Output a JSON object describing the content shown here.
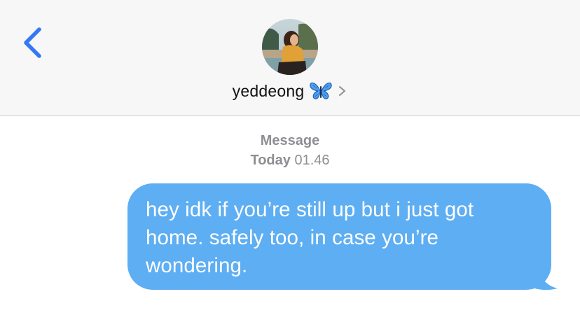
{
  "header": {
    "contact_name": "yeddeong",
    "contact_emoji": "butterfly-icon"
  },
  "conversation": {
    "service_label": "Message",
    "day_label": "Today",
    "time_label": "01.46"
  },
  "messages": [
    {
      "direction": "outgoing",
      "text": "hey idk if you’re still up but i just got home. safely too, in case you’re wondering."
    }
  ],
  "colors": {
    "accent": "#3478f6",
    "bubble": "#5eaef3",
    "header_bg": "#f7f7f7",
    "meta_text": "#8e8e93"
  }
}
